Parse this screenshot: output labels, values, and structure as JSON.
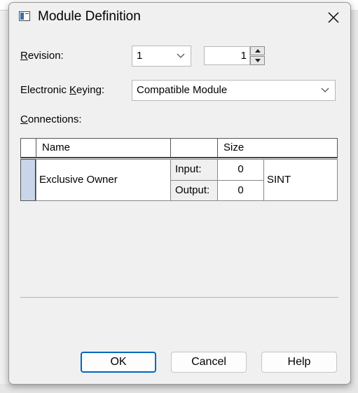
{
  "dialog": {
    "title": "Module Definition"
  },
  "revision": {
    "label_accel": "R",
    "label_rest": "evision:",
    "major": "1",
    "minor": "1"
  },
  "keying": {
    "label_pre": "Electronic ",
    "label_accel": "K",
    "label_rest": "eying:",
    "value": "Compatible Module"
  },
  "connections": {
    "label_accel": "C",
    "label_rest": "onnections:",
    "headers": {
      "name": "Name",
      "blank": "",
      "size": "Size"
    },
    "rows": [
      {
        "name": "Exclusive Owner",
        "input_label": "Input:",
        "input_size": "0",
        "output_label": "Output:",
        "output_size": "0",
        "type": "SINT"
      }
    ]
  },
  "buttons": {
    "ok": "OK",
    "cancel": "Cancel",
    "help": "Help"
  },
  "colors": {
    "accent": "#0067c0",
    "row_indicator": "#c9d6ea"
  }
}
